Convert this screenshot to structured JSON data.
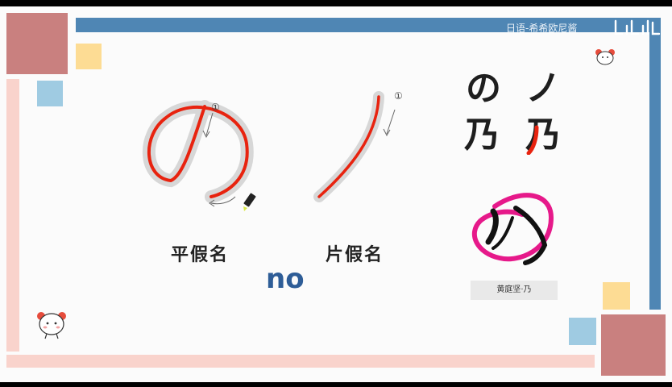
{
  "header": {
    "channel_name": "日语-希希欧尼酱"
  },
  "labels": {
    "hiragana": "平假名",
    "katakana": "片假名",
    "romaji": "no"
  },
  "chars": {
    "hiragana": "の",
    "katakana": "ノ",
    "origin": "乃",
    "origin_highlighted": "乃"
  },
  "stroke_number": "①",
  "caption": "黄庭坚·乃",
  "colors": {
    "accent_blue": "#4f86b4",
    "rose": "#c9807f",
    "peach": "#f9d3cc",
    "yellow": "#fddc94",
    "light_blue": "#9fcbe2",
    "stroke_red": "#e8230f",
    "pink": "#e6198a"
  }
}
